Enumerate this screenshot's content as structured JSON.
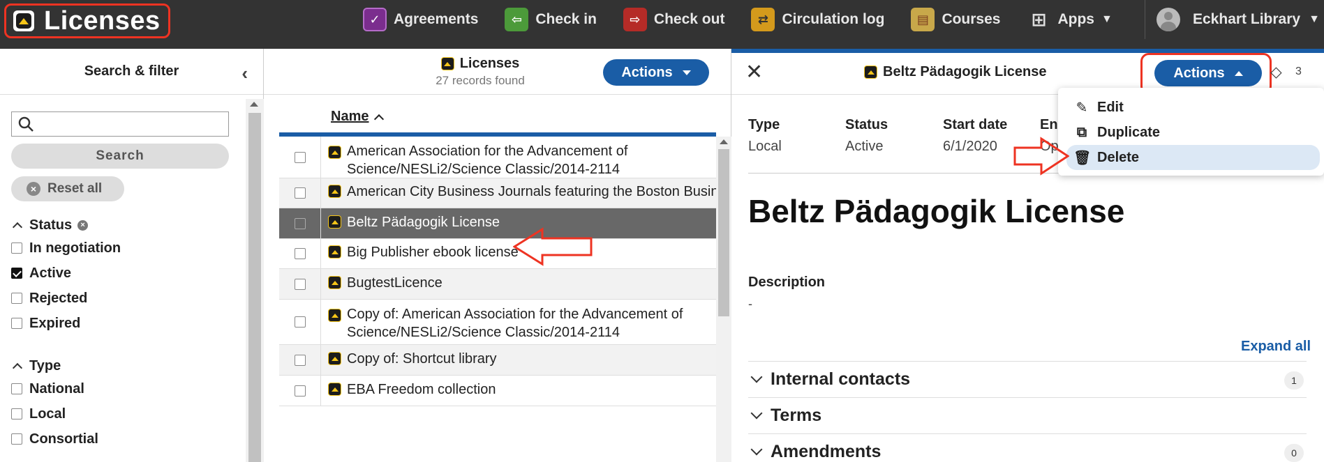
{
  "app": {
    "title": "Licenses"
  },
  "nav": {
    "items": [
      {
        "label": "Agreements",
        "icon": "agreements-icon",
        "color": "#7b2d8e"
      },
      {
        "label": "Check in",
        "icon": "check-in-icon",
        "color": "#4c9a3a"
      },
      {
        "label": "Check out",
        "icon": "check-out-icon",
        "color": "#b52b27"
      },
      {
        "label": "Circulation log",
        "icon": "circulation-log-icon",
        "color": "#d49a1c"
      },
      {
        "label": "Courses",
        "icon": "courses-icon",
        "color": "#c8a84a"
      },
      {
        "label": "Apps",
        "icon": "apps-grid-icon",
        "color": "#333333"
      }
    ],
    "user": "Eckhart Library"
  },
  "filter": {
    "header": "Search & filter",
    "search_placeholder": "",
    "search_label": "Search",
    "reset_label": "Reset all",
    "groups": [
      {
        "label": "Status",
        "options": [
          {
            "label": "In negotiation",
            "checked": false
          },
          {
            "label": "Active",
            "checked": true
          },
          {
            "label": "Rejected",
            "checked": false
          },
          {
            "label": "Expired",
            "checked": false
          }
        ]
      },
      {
        "label": "Type",
        "options": [
          {
            "label": "National",
            "checked": false
          },
          {
            "label": "Local",
            "checked": false
          },
          {
            "label": "Consortial",
            "checked": false
          }
        ]
      }
    ]
  },
  "results": {
    "title": "Licenses",
    "count": "27 records found",
    "actions_label": "Actions",
    "column_name": "Name",
    "rows": [
      {
        "name": "American Association for the Advancement of Science/NESLi2/Science Classic/2014-2114",
        "selected": false
      },
      {
        "name": "American City Business Journals featuring the Boston Business Journal",
        "selected": false
      },
      {
        "name": "Beltz Pädagogik License",
        "selected": true
      },
      {
        "name": "Big Publisher ebook license",
        "selected": false
      },
      {
        "name": "BugtestLicence",
        "selected": false
      },
      {
        "name": "Copy of: American Association for the Advancement of Science/NESLi2/Science Classic/2014-2114",
        "selected": false
      },
      {
        "name": "Copy of: Shortcut library",
        "selected": false
      },
      {
        "name": "EBA Freedom collection",
        "selected": false
      }
    ]
  },
  "detail": {
    "header_title": "Beltz Pädagogik License",
    "actions_label": "Actions",
    "tag_count": "3",
    "fields": [
      {
        "label": "Type",
        "value": "Local"
      },
      {
        "label": "Status",
        "value": "Active"
      },
      {
        "label": "Start date",
        "value": "6/1/2020"
      },
      {
        "label": "En",
        "value": "Op"
      }
    ],
    "title": "Beltz Pädagogik License",
    "description_label": "Description",
    "description_value": "-",
    "expand_all": "Expand all",
    "sections": [
      {
        "label": "Internal contacts",
        "badge": "1"
      },
      {
        "label": "Terms",
        "badge": ""
      },
      {
        "label": "Amendments",
        "badge": "0"
      }
    ]
  },
  "menu": {
    "items": [
      {
        "label": "Edit",
        "icon": "pencil-icon"
      },
      {
        "label": "Duplicate",
        "icon": "duplicate-icon"
      },
      {
        "label": "Delete",
        "icon": "trash-icon"
      }
    ]
  }
}
